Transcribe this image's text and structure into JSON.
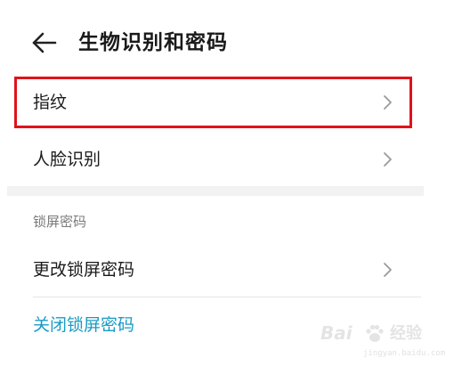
{
  "header": {
    "title": "生物识别和密码"
  },
  "biometrics": {
    "items": [
      {
        "label": "指纹"
      },
      {
        "label": "人脸识别"
      }
    ]
  },
  "lock_screen": {
    "section_title": "锁屏密码",
    "change_label": "更改锁屏密码",
    "disable_label": "关闭锁屏密码"
  },
  "watermark": {
    "logo_text": "Bai",
    "logo_suffix": "经验",
    "sub_text": "jingyan.baidu.com"
  },
  "colors": {
    "highlight": "#e0121b",
    "link": "#1a9bc4",
    "section_bg": "#f2f2f2"
  }
}
